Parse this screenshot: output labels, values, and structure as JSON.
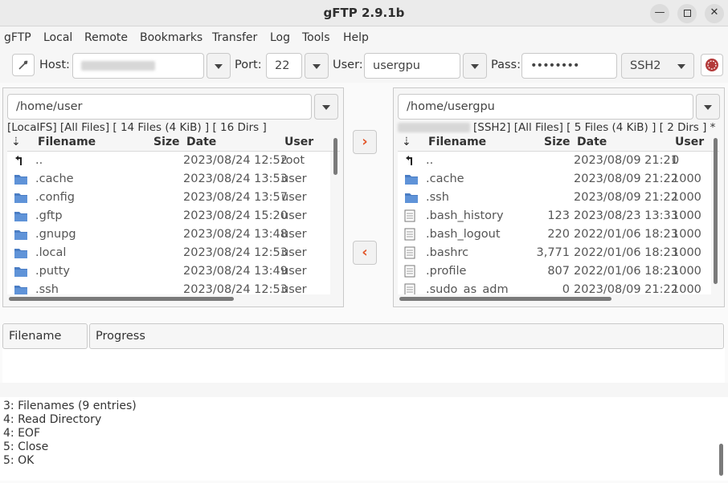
{
  "window": {
    "title": "gFTP 2.9.1b"
  },
  "menubar": {
    "items": [
      "gFTP",
      "Local",
      "Remote",
      "Bookmarks",
      "Transfer",
      "Log",
      "Tools",
      "Help"
    ]
  },
  "toolbar": {
    "host_label": "Host:",
    "port_label": "Port:",
    "port_value": "22",
    "user_label": "User:",
    "user_value": "usergpu",
    "pass_label": "Pass:",
    "pass_value": "••••••••",
    "protocol": "SSH2"
  },
  "local": {
    "path": "/home/user",
    "status": "[LocalFS] [All Files] [ 14 Files (4 KiB) ]  [ 16 Dirs ]",
    "columns": {
      "filename": "Filename",
      "size": "Size",
      "date": "Date",
      "user": "User"
    },
    "rows": [
      {
        "icon": "parent",
        "name": "..",
        "size": "",
        "date": "2023/08/24 12:52",
        "user": "root"
      },
      {
        "icon": "folder",
        "name": ".cache",
        "size": "",
        "date": "2023/08/24 13:53",
        "user": "user"
      },
      {
        "icon": "folder",
        "name": ".config",
        "size": "",
        "date": "2023/08/24 13:57",
        "user": "user"
      },
      {
        "icon": "folder",
        "name": ".gftp",
        "size": "",
        "date": "2023/08/24 15:20",
        "user": "user"
      },
      {
        "icon": "folder",
        "name": ".gnupg",
        "size": "",
        "date": "2023/08/24 13:48",
        "user": "user"
      },
      {
        "icon": "folder",
        "name": ".local",
        "size": "",
        "date": "2023/08/24 12:53",
        "user": "user"
      },
      {
        "icon": "folder",
        "name": ".putty",
        "size": "",
        "date": "2023/08/24 13:49",
        "user": "user"
      },
      {
        "icon": "folder",
        "name": ".ssh",
        "size": "",
        "date": "2023/08/24 12:53",
        "user": "user"
      }
    ]
  },
  "remote": {
    "path": "/home/usergpu",
    "status": "[SSH2] [All Files] [ 5 Files (4 KiB) ]  [ 2 Dirs ] *",
    "columns": {
      "filename": "Filename",
      "size": "Size",
      "date": "Date",
      "user": "User"
    },
    "rows": [
      {
        "icon": "parent",
        "name": "..",
        "size": "",
        "date": "2023/08/09 21:21",
        "user": "0"
      },
      {
        "icon": "folder",
        "name": ".cache",
        "size": "",
        "date": "2023/08/09 21:22",
        "user": "1000"
      },
      {
        "icon": "folder",
        "name": ".ssh",
        "size": "",
        "date": "2023/08/09 21:22",
        "user": "1000"
      },
      {
        "icon": "file",
        "name": ".bash_history",
        "size": "123",
        "date": "2023/08/23 13:33",
        "user": "1000"
      },
      {
        "icon": "file",
        "name": ".bash_logout",
        "size": "220",
        "date": "2022/01/06 18:23",
        "user": "1000"
      },
      {
        "icon": "file",
        "name": ".bashrc",
        "size": "3,771",
        "date": "2022/01/06 18:23",
        "user": "1000"
      },
      {
        "icon": "file",
        "name": ".profile",
        "size": "807",
        "date": "2022/01/06 18:23",
        "user": "1000"
      },
      {
        "icon": "file",
        "name": ".sudo_as_adm",
        "size": "0",
        "date": "2023/08/09 21:22",
        "user": "1000"
      }
    ]
  },
  "transfers": {
    "col_filename": "Filename",
    "col_progress": "Progress"
  },
  "log": {
    "lines": [
      "3: Filenames (9 entries)",
      "4: Read Directory",
      "4: EOF",
      "5: Close",
      "5: OK"
    ]
  },
  "colors": {
    "accent": "#e2562a",
    "folder": "#4a7dc4"
  }
}
